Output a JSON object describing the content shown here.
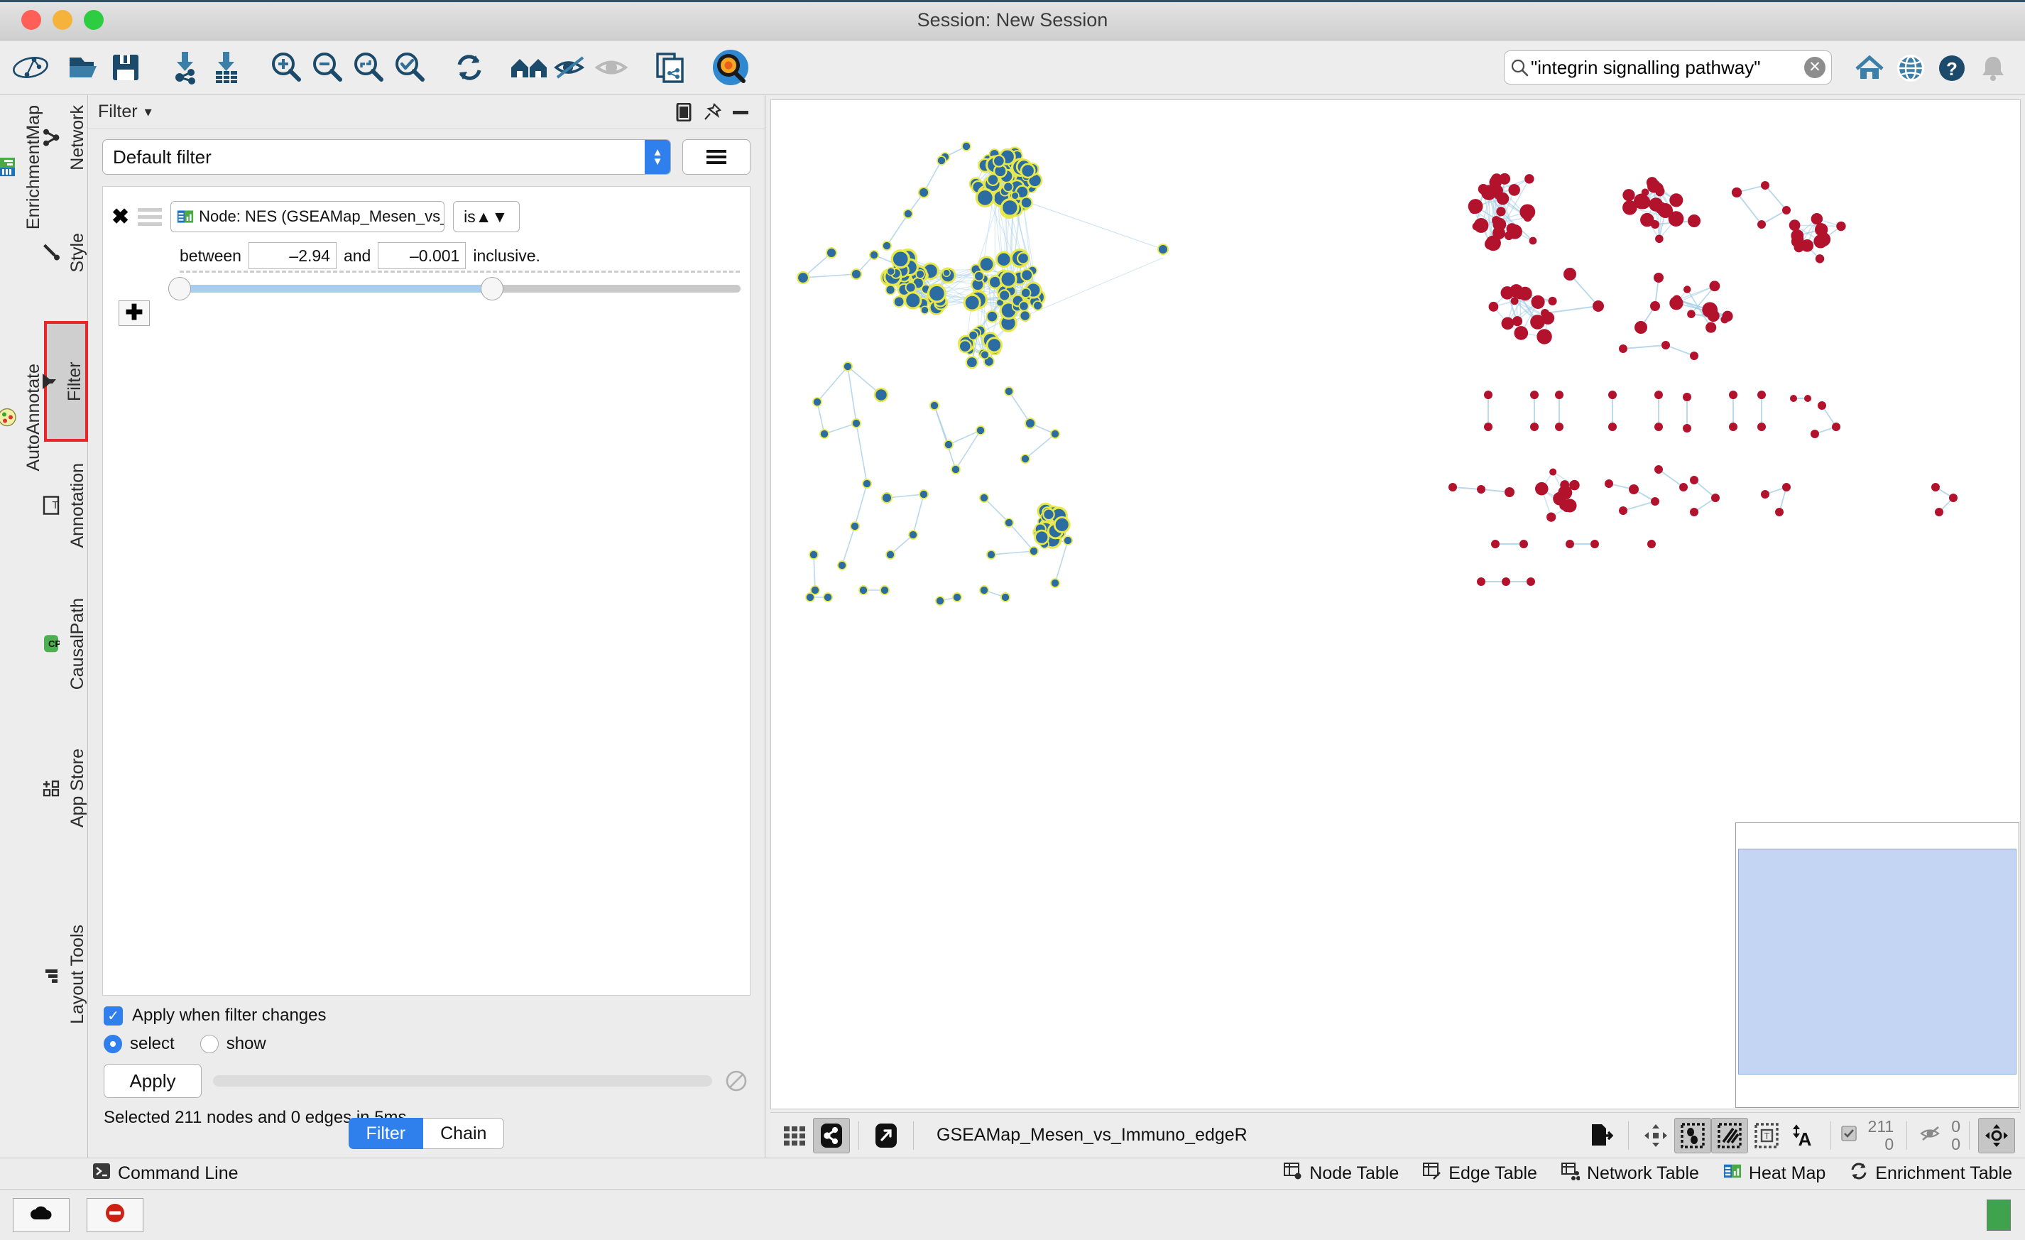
{
  "window": {
    "title": "Session: New Session",
    "controls": [
      "close",
      "minimize",
      "maximize"
    ]
  },
  "toolbar": {
    "items": [
      {
        "name": "cytoscape-logo-icon",
        "label": "Cytoscape"
      },
      {
        "name": "open-file-icon",
        "label": "Open"
      },
      {
        "name": "save-session-icon",
        "label": "Save"
      },
      {
        "name": "import-network-icon",
        "label": "Import Network"
      },
      {
        "name": "import-table-icon",
        "label": "Import Table"
      },
      {
        "name": "zoom-in-icon",
        "label": "Zoom In"
      },
      {
        "name": "zoom-out-icon",
        "label": "Zoom Out"
      },
      {
        "name": "zoom-fit-icon",
        "label": "Fit Network"
      },
      {
        "name": "zoom-selected-icon",
        "label": "Fit Selected"
      },
      {
        "name": "refresh-icon",
        "label": "Refresh"
      },
      {
        "name": "home-layout-icon",
        "label": "Layout"
      },
      {
        "name": "hide-selected-icon",
        "label": "Hide Selected"
      },
      {
        "name": "show-all-icon",
        "label": "Show All"
      },
      {
        "name": "copy-network-icon",
        "label": "Clone Network"
      },
      {
        "name": "search-app-icon",
        "label": "Search Apps"
      }
    ],
    "right_items": [
      {
        "name": "home-icon",
        "label": "Home"
      },
      {
        "name": "globe-icon",
        "label": "Web"
      },
      {
        "name": "help-icon",
        "label": "Help"
      },
      {
        "name": "bell-icon",
        "label": "Notifications"
      }
    ]
  },
  "search": {
    "value": "\"integrin signalling pathway\"",
    "placeholder": "Search",
    "icon": "search-icon",
    "clear_icon": "clear-icon",
    "clear_glyph": "✕"
  },
  "rail": {
    "columns": [
      {
        "name": "left-rail",
        "items": [
          {
            "label": "EnrichmentMap",
            "icon": "enrichmentmap-icon",
            "selected": false
          },
          {
            "label": "AutoAnnotate",
            "icon": "autoannotate-icon",
            "selected": false
          }
        ]
      },
      {
        "name": "right-rail",
        "items": [
          {
            "label": "Network",
            "icon": "network-icon",
            "selected": false
          },
          {
            "label": "Style",
            "icon": "style-brush-icon",
            "selected": false
          },
          {
            "label": "Filter",
            "icon": "filter-funnel-icon",
            "selected": true
          },
          {
            "label": "Annotation",
            "icon": "annotation-text-icon",
            "selected": false
          },
          {
            "label": "CausalPath",
            "icon": "causalpath-icon",
            "selected": false
          },
          {
            "label": "App Store",
            "icon": "appstore-icon",
            "selected": false
          },
          {
            "label": "Layout Tools",
            "icon": "layout-tools-icon",
            "selected": false
          }
        ]
      }
    ]
  },
  "filter_panel": {
    "header": {
      "title": "Filter",
      "dropdown_glyph": "▾",
      "float_icon": "float-window-icon",
      "pin_icon": "pin-icon",
      "minimize_icon": "minimize-icon"
    },
    "filter_select": {
      "value": "Default filter",
      "options": [
        "Default filter"
      ]
    },
    "menu_button": {
      "name": "filter-options-menu",
      "icon": "hamburger-icon"
    },
    "condition": {
      "remove_glyph": "✖",
      "attribute": "Node: NES (GSEAMap_Mesen_vs_Immuno_e...",
      "attribute_icon": "enrichmentmap-column-icon",
      "operator": "is",
      "between_label": "between",
      "min_value": "–2.94",
      "and_label": "and",
      "max_value": "–0.001",
      "inclusive_label": "inclusive.",
      "slider": {
        "fill_percent": 55
      }
    },
    "add_condition_button": {
      "glyph": "✚",
      "label": "Add condition"
    },
    "apply_when_changes": {
      "label": "Apply when filter changes",
      "checked": true,
      "check_glyph": "✓"
    },
    "mode": {
      "options": [
        "select",
        "show"
      ],
      "selected": "select"
    },
    "apply_button": "Apply",
    "cancel_icon": "cancel-icon",
    "status": "Selected 211 nodes and 0 edges in 5ms",
    "tabs": [
      {
        "label": "Filter",
        "active": true
      },
      {
        "label": "Chain",
        "active": false
      }
    ]
  },
  "network_view": {
    "title": "GSEAMap_Mesen_vs_Immuno_edgeR",
    "left_icons": [
      {
        "name": "grid-view-icon",
        "pressed": false
      },
      {
        "name": "network-view-icon",
        "pressed": true
      },
      {
        "name": "detach-view-icon",
        "pressed": false
      }
    ],
    "right_icons": [
      {
        "name": "export-image-icon",
        "pressed": false
      },
      {
        "name": "move-nodes-icon",
        "pressed": false
      },
      {
        "name": "select-nodes-icon",
        "pressed": true
      },
      {
        "name": "select-edges-icon",
        "pressed": true
      },
      {
        "name": "select-annotations-icon",
        "pressed": false
      },
      {
        "name": "move-labels-icon",
        "pressed": false
      },
      {
        "name": "navigator-toggle-icon",
        "pressed": true
      }
    ],
    "selected_icon": "selected-check-icon",
    "hidden_icon": "hidden-eye-icon",
    "selected_nodes": "211",
    "selected_edges": "0",
    "hidden_nodes": "0",
    "hidden_edges": "0"
  },
  "bottom_tabs": {
    "left": [
      {
        "label": "Command Line",
        "icon": "terminal-icon"
      }
    ],
    "right": [
      {
        "label": "Node Table",
        "icon": "node-table-icon"
      },
      {
        "label": "Edge Table",
        "icon": "edge-table-icon"
      },
      {
        "label": "Network Table",
        "icon": "network-table-icon"
      },
      {
        "label": "Heat Map",
        "icon": "heatmap-icon"
      },
      {
        "label": "Enrichment Table",
        "icon": "enrichment-table-icon"
      }
    ]
  },
  "statusbar": {
    "buttons": [
      {
        "name": "cloud-status-button",
        "icon": "cloud-icon"
      },
      {
        "name": "error-status-button",
        "icon": "error-stop-icon"
      }
    ],
    "memory_indicator": {
      "name": "memory-meter",
      "color": "#3fa34d"
    }
  },
  "colors": {
    "node_blue": "#2b6ca3",
    "node_red": "#b3122d",
    "node_selected_border": "#e8e84a",
    "edge": "#a8cfe8",
    "accent_blue": "#2f80ed",
    "highlight_red": "#e8262a",
    "navigator_viewport": "#c3d5f3"
  }
}
